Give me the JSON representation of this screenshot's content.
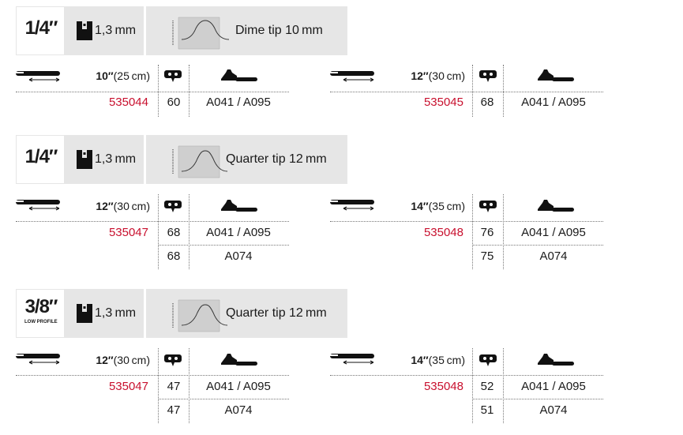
{
  "colors": {
    "accent_red": "#c8102e",
    "header_gray": "#e6e6e6",
    "text": "#1a1a1a"
  },
  "icons": {
    "bar_length": "guide-bar-length-icon",
    "gauge": "gauge-icon",
    "drive_links": "drive-link-icon",
    "chainsaw": "chainsaw-icon",
    "bar_tip": "bar-tip-outline-icon"
  },
  "sections": [
    {
      "pitch": "1/4″",
      "pitch_sub": "",
      "gauge": "1,3 mm",
      "tip": "Dime tip 10 mm",
      "groups": [
        {
          "length_bold": "10″",
          "length_rest": "(25 cm)",
          "part": "535044",
          "rows": [
            {
              "links": "60",
              "model": "A041 / A095"
            }
          ]
        },
        {
          "length_bold": "12″",
          "length_rest": "(30 cm)",
          "part": "535045",
          "rows": [
            {
              "links": "68",
              "model": "A041 / A095"
            }
          ]
        }
      ]
    },
    {
      "pitch": "1/4″",
      "pitch_sub": "",
      "gauge": "1,3 mm",
      "tip": "Quarter tip 12 mm",
      "groups": [
        {
          "length_bold": "12″",
          "length_rest": "(30 cm)",
          "part": "535047",
          "rows": [
            {
              "links": "68",
              "model": "A041 / A095"
            },
            {
              "links": "68",
              "model": "A074"
            }
          ]
        },
        {
          "length_bold": "14″",
          "length_rest": "(35 cm)",
          "part": "535048",
          "rows": [
            {
              "links": "76",
              "model": "A041 / A095"
            },
            {
              "links": "75",
              "model": "A074"
            }
          ]
        }
      ]
    },
    {
      "pitch": "3/8″",
      "pitch_sub": "LOW PROFILE",
      "gauge": "1,3 mm",
      "tip": "Quarter tip 12 mm",
      "groups": [
        {
          "length_bold": "12″",
          "length_rest": "(30 cm)",
          "part": "535047",
          "rows": [
            {
              "links": "47",
              "model": "A041 / A095"
            },
            {
              "links": "47",
              "model": "A074"
            }
          ]
        },
        {
          "length_bold": "14″",
          "length_rest": "(35 cm)",
          "part": "535048",
          "rows": [
            {
              "links": "52",
              "model": "A041 / A095"
            },
            {
              "links": "51",
              "model": "A074"
            }
          ]
        }
      ]
    }
  ]
}
